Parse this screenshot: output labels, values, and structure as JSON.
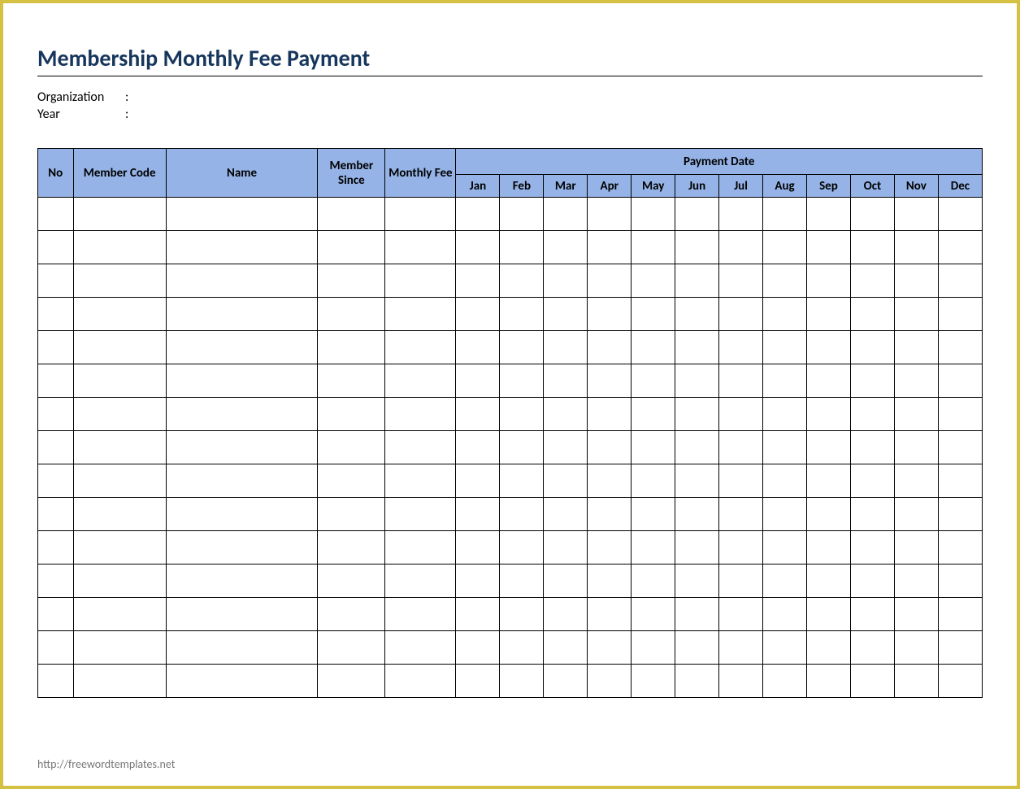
{
  "title": "Membership Monthly Fee Payment",
  "meta": {
    "organization_label": "Organization",
    "organization_value": "",
    "year_label": "Year",
    "year_value": "",
    "colon": ":"
  },
  "headers": {
    "no": "No",
    "member_code": "Member Code",
    "name": "Name",
    "member_since": "Member Since",
    "monthly_fee": "Monthly Fee",
    "payment_date": "Payment Date"
  },
  "months": [
    "Jan",
    "Feb",
    "Mar",
    "Apr",
    "May",
    "Jun",
    "Jul",
    "Aug",
    "Sep",
    "Oct",
    "Nov",
    "Dec"
  ],
  "row_count": 15,
  "footer": "http://freewordtemplates.net"
}
